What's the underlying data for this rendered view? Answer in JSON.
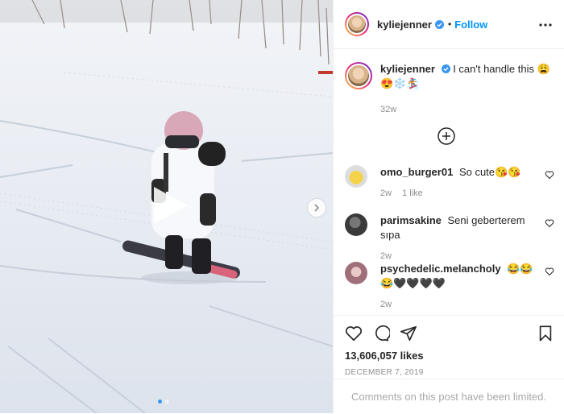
{
  "post": {
    "username": "kyliejenner",
    "follow_label": "Follow",
    "separator": "•",
    "caption_text": "I can't handle this 😩😍❄️🏂",
    "caption_time": "32w",
    "likes": "13,606,057 likes",
    "date": "DECEMBER 7, 2019",
    "comments_limited": "Comments on this post have been limited."
  },
  "comments": [
    {
      "username": "omo_burger01",
      "text": "So cute😘😘",
      "time": "2w",
      "likes": "1 like"
    },
    {
      "username": "parimsakine",
      "text": "Seni geberterem sıpa",
      "time": "2w",
      "likes": ""
    },
    {
      "username": "psychedelic.melancholy",
      "text": "😂😂😂🖤🖤🖤🖤",
      "time": "2w",
      "likes": ""
    }
  ],
  "icons": {
    "verified": "verified-badge-icon",
    "more": "more-options-icon",
    "load_more": "load-more-comments-icon",
    "like": "heart-icon",
    "comment": "comment-icon",
    "share": "share-icon",
    "save": "bookmark-icon",
    "play": "play-icon",
    "next": "chevron-right-icon"
  },
  "colors": {
    "link": "#0095f6",
    "verified": "#3897f0",
    "muted": "#8e8e8e"
  }
}
